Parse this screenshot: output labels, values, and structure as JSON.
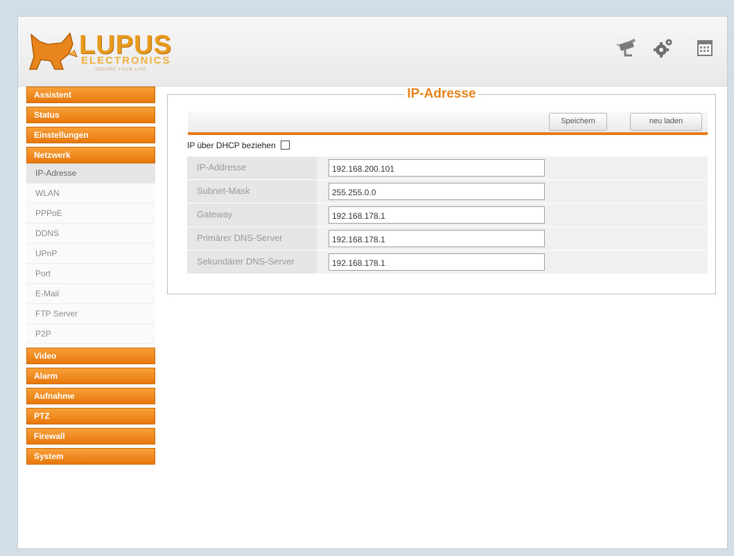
{
  "brand": {
    "name": "LUPUS",
    "sub": "ELECTRONICS",
    "tagline": "SECURE YOUR LIFE"
  },
  "header_icons": [
    "camera-icon",
    "settings-gear-icon",
    "calendar-icon"
  ],
  "colors": {
    "accent": "#e8821a",
    "sidebar_orange": "#ef8a1e"
  },
  "sidebar": {
    "categories_top": [
      "Assistent",
      "Status",
      "Einstellungen",
      "Netzwerk"
    ],
    "network_items": [
      "IP-Adresse",
      "WLAN",
      "PPPoE",
      "DDNS",
      "UPnP",
      "Port",
      "E-Mail",
      "FTP Server",
      "P2P"
    ],
    "categories_bottom": [
      "Video",
      "Alarm",
      "Aufnahme",
      "PTZ",
      "Firewall",
      "System"
    ]
  },
  "panel": {
    "title": "IP-Adresse",
    "save_label": "Speichern",
    "reload_label": "neu laden",
    "dhcp_label": "IP über DHCP beziehen",
    "dhcp_checked": false,
    "fields": [
      {
        "label": "IP-Addresse",
        "value": "192.168.200.101"
      },
      {
        "label": "Subnet-Mask",
        "value": "255.255.0.0"
      },
      {
        "label": "Gateway",
        "value": "192.168.178.1"
      },
      {
        "label": "Primärer DNS-Server",
        "value": "192.168.178.1"
      },
      {
        "label": "Sekundärer DNS-Server",
        "value": "192.168.178.1"
      }
    ]
  }
}
